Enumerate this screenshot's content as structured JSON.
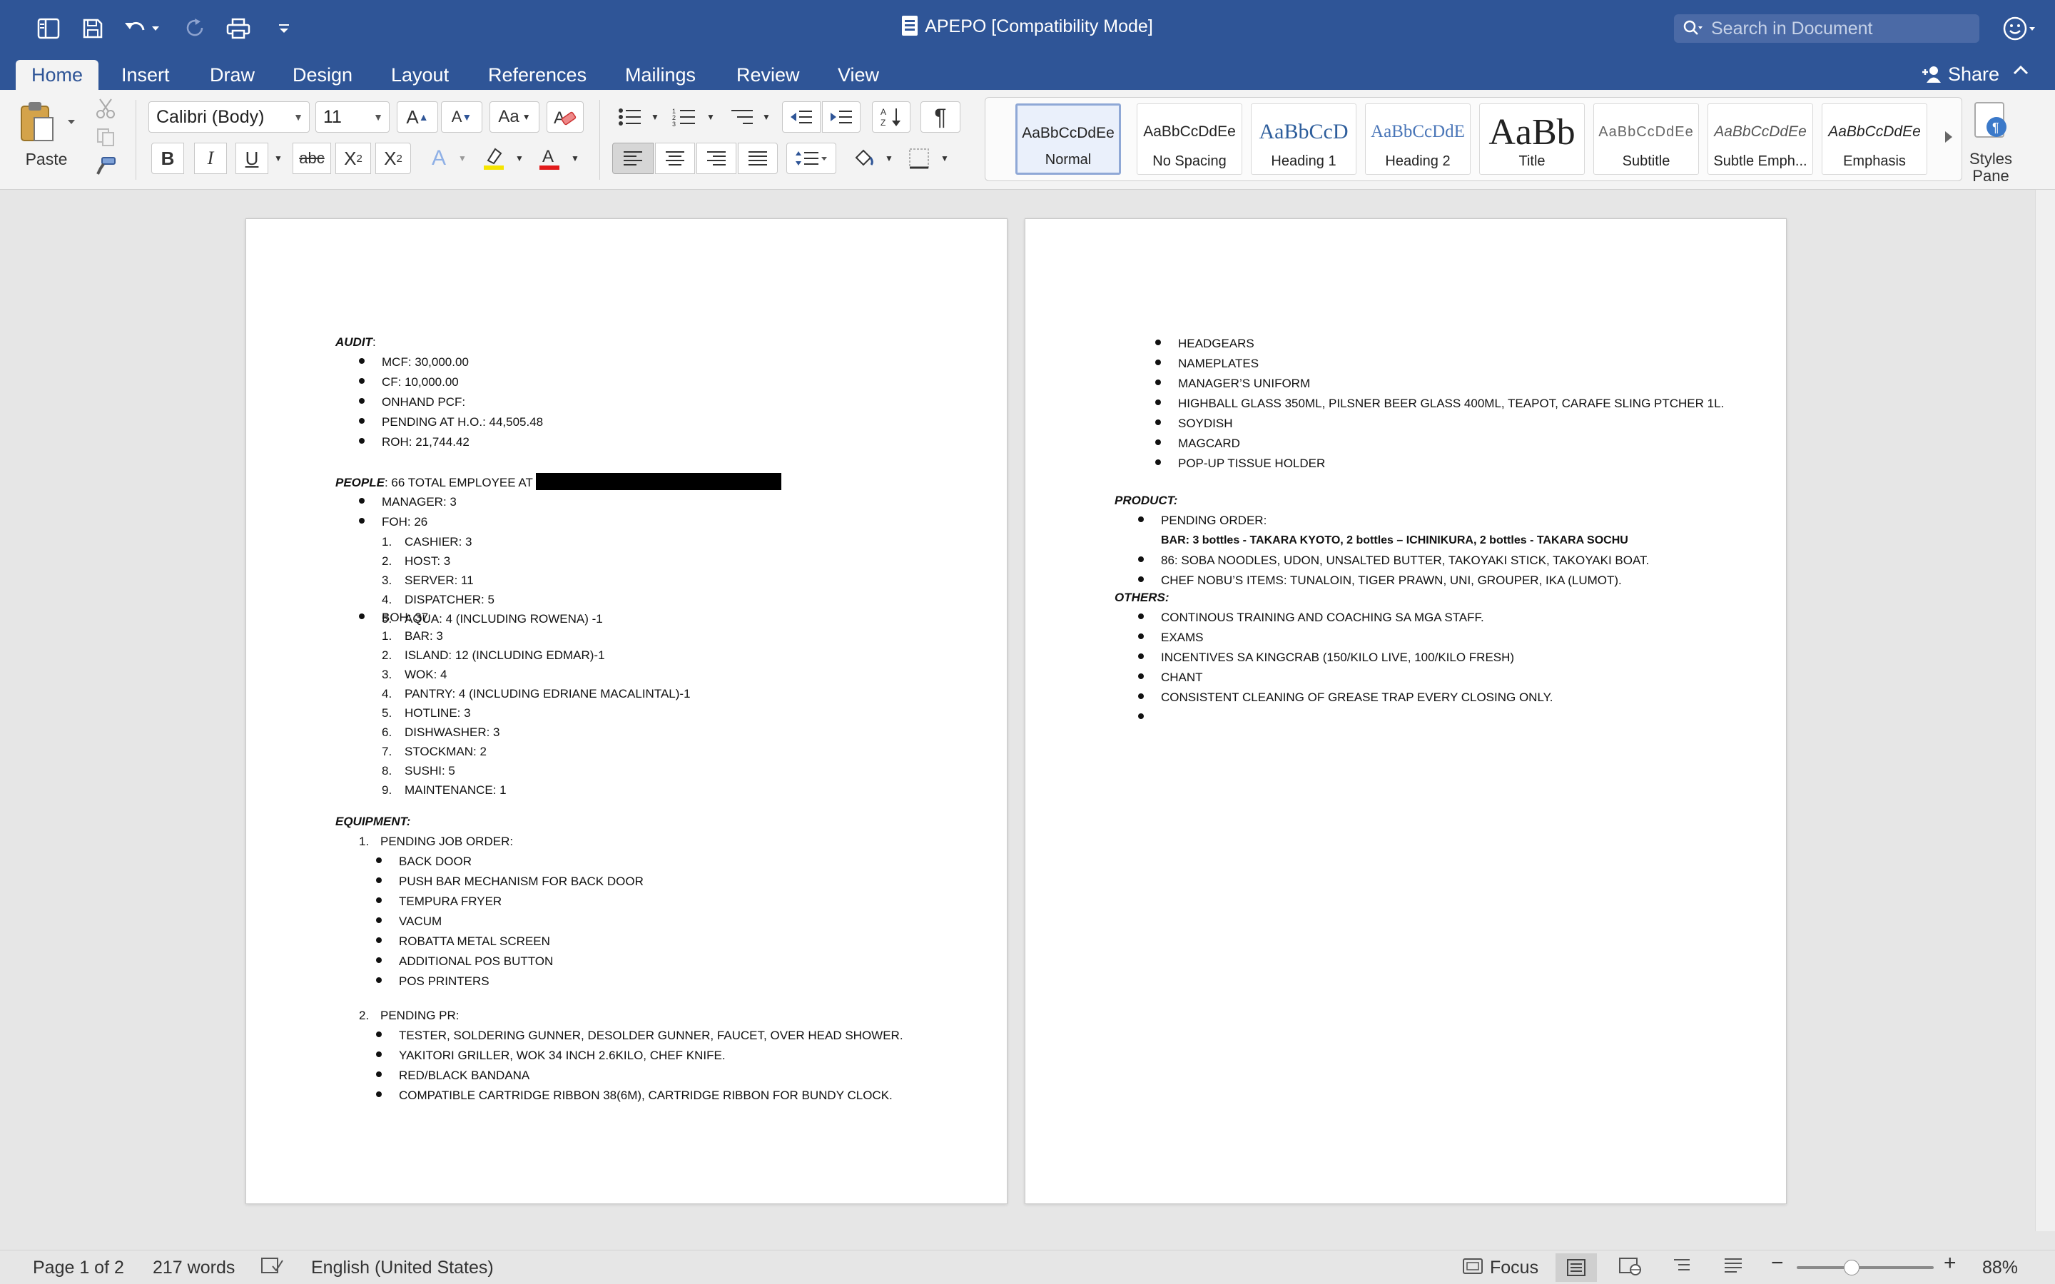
{
  "window": {
    "title": "APEPO [Compatibility Mode]",
    "search_placeholder": "Search in Document"
  },
  "tabs": [
    "Home",
    "Insert",
    "Draw",
    "Design",
    "Layout",
    "References",
    "Mailings",
    "Review",
    "View"
  ],
  "active_tab": "Home",
  "share_label": "Share",
  "ribbon": {
    "paste_label": "Paste",
    "font_name": "Calibri (Body)",
    "font_size": "11",
    "styles": [
      {
        "sample": "AaBbCcDdEe",
        "name": "Normal"
      },
      {
        "sample": "AaBbCcDdEe",
        "name": "No Spacing"
      },
      {
        "sample": "AaBbCcD",
        "name": "Heading 1"
      },
      {
        "sample": "AaBbCcDdE",
        "name": "Heading 2"
      },
      {
        "sample": "AaBb",
        "name": "Title"
      },
      {
        "sample": "AaBbCcDdEe",
        "name": "Subtitle"
      },
      {
        "sample": "AaBbCcDdEe",
        "name": "Subtle Emph..."
      },
      {
        "sample": "AaBbCcDdEe",
        "name": "Emphasis"
      }
    ],
    "styles_pane_label_1": "Styles",
    "styles_pane_label_2": "Pane",
    "icons": {
      "bold": "B",
      "italic": "I",
      "underline": "U",
      "strike": "abc",
      "subscript": "X2",
      "superscript": "X2",
      "font_color": "A",
      "highlight_color": "#f5e400",
      "font_color_swatch": "#e21a1a"
    }
  },
  "page1": {
    "audit_header": "AUDIT",
    "audit_items": [
      "MCF: 30,000.00",
      "CF: 10,000.00",
      "ONHAND PCF:",
      "PENDING AT H.O.: 44,505.48",
      "ROH: 21,744.42"
    ],
    "people_header": "PEOPLE",
    "people_text": ": 66 TOTAL EMPLOYEE AT",
    "manager": "MANAGER: 3",
    "foh": "FOH: 26",
    "foh_items": [
      "CASHIER: 3",
      "HOST: 3",
      "SERVER: 11",
      "DISPATCHER: 5",
      "AQUA: 4 (INCLUDING ROWENA) -1"
    ],
    "boh": "BOH: 37",
    "boh_items": [
      "BAR: 3",
      "ISLAND: 12 (INCLUDING EDMAR)-1",
      "WOK: 4",
      "PANTRY: 4 (INCLUDING EDRIANE MACALINTAL)-1",
      "HOTLINE: 3",
      "DISHWASHER: 3",
      "STOCKMAN: 2",
      "SUSHI: 5",
      "MAINTENANCE: 1"
    ],
    "equipment_header": "EQUIPMENT:",
    "pending_job_order": "PENDING JOB ORDER:",
    "job_order_items": [
      "BACK DOOR",
      "PUSH BAR MECHANISM FOR BACK DOOR",
      "TEMPURA FRYER",
      "VACUM",
      "ROBATTA METAL SCREEN",
      "ADDITIONAL POS BUTTON",
      "POS PRINTERS"
    ],
    "pending_pr": "PENDING PR:",
    "pr_items": [
      "TESTER, SOLDERING GUNNER, DESOLDER GUNNER, FAUCET, OVER HEAD SHOWER.",
      "YAKITORI GRILLER, WOK 34 INCH 2.6KILO, CHEF KNIFE.",
      "RED/BLACK BANDANA",
      "COMPATIBLE CARTRIDGE RIBBON 38(6M), CARTRIDGE RIBBON FOR BUNDY CLOCK."
    ]
  },
  "page2": {
    "top_items": [
      "HEADGEARS",
      "NAMEPLATES",
      "MANAGER’S UNIFORM",
      "HIGHBALL GLASS 350ML, PILSNER BEER GLASS 400ML, TEAPOT, CARAFE SLING PTCHER 1L.",
      "SOYDISH",
      "MAGCARD",
      "POP-UP TISSUE HOLDER"
    ],
    "product_header": "PRODUCT:",
    "pending_order": "PENDING ORDER:",
    "pending_order_detail": "BAR: 3 bottles - TAKARA KYOTO, 2 bottles – ICHINIKURA, 2 bottles - TAKARA SOCHU",
    "product_items": [
      "86: SOBA NOODLES, UDON, UNSALTED BUTTER, TAKOYAKI STICK, TAKOYAKI BOAT.",
      "CHEF NOBU’S ITEMS: TUNALOIN, TIGER PRAWN, UNI, GROUPER, IKA (LUMOT)."
    ],
    "others_header": "OTHERS:",
    "others_items": [
      "CONTINOUS TRAINING AND COACHING SA MGA STAFF.",
      "EXAMS",
      "INCENTIVES SA KINGCRAB (150/KILO LIVE, 100/KILO FRESH)",
      "CHANT",
      "CONSISTENT CLEANING OF GREASE TRAP EVERY CLOSING ONLY.",
      ""
    ]
  },
  "status": {
    "page": "Page 1 of 2",
    "words": "217 words",
    "language": "English (United States)",
    "focus": "Focus",
    "zoom": "88%",
    "zoom_fraction": 0.4
  }
}
